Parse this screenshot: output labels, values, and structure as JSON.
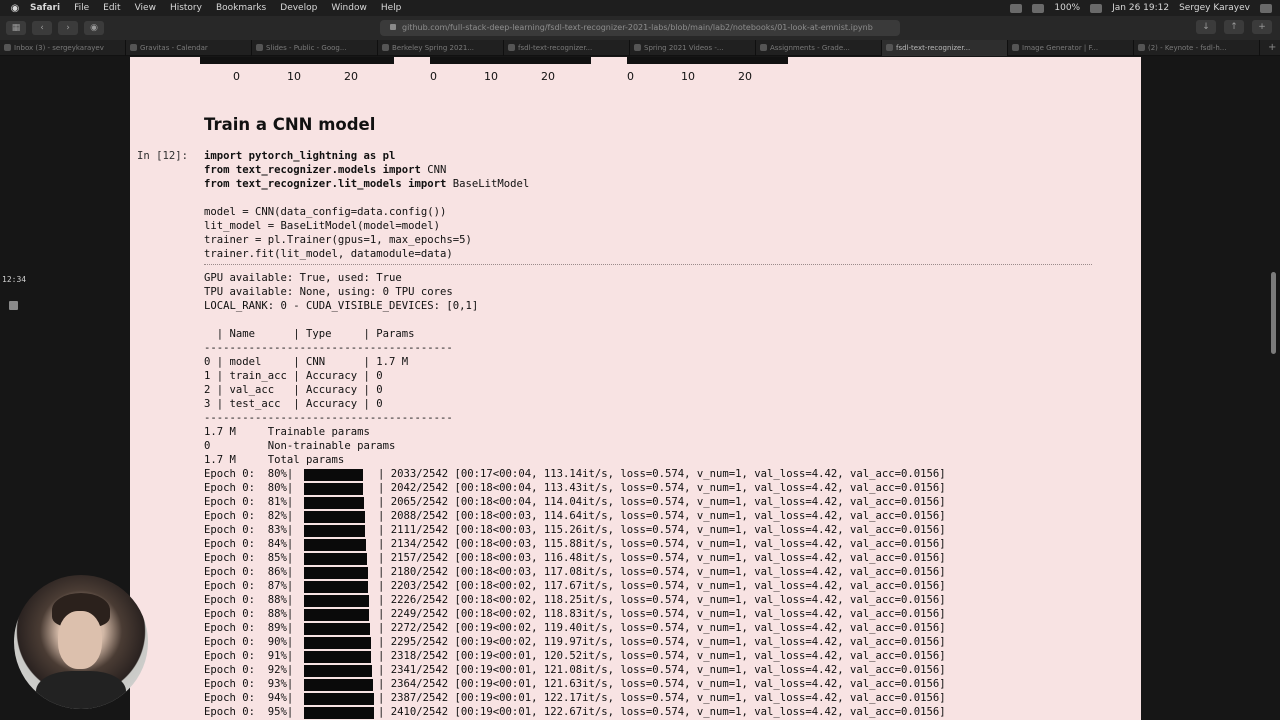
{
  "menubar": {
    "app_name": "Safari",
    "items": [
      "File",
      "Edit",
      "View",
      "History",
      "Bookmarks",
      "Develop",
      "Window",
      "Help"
    ],
    "battery": "100%",
    "datetime": "Jan 26  19:12",
    "user": "Sergey Karayev"
  },
  "toolbar": {
    "url": "github.com/full-stack-deep-learning/fsdl-text-recognizer-2021-labs/blob/main/lab2/notebooks/01-look-at-emnist.ipynb"
  },
  "tabs": [
    {
      "label": "Inbox (3) - sergeykarayev",
      "active": false
    },
    {
      "label": "Gravitas - Calendar",
      "active": false
    },
    {
      "label": "Slides - Public - Goog...",
      "active": false
    },
    {
      "label": "Berkeley Spring 2021...",
      "active": false
    },
    {
      "label": "fsdl-text-recognizer...",
      "active": false
    },
    {
      "label": "Spring 2021 Videos -...",
      "active": false
    },
    {
      "label": "Assignments - Grade...",
      "active": false
    },
    {
      "label": "fsdl-text-recognizer...",
      "active": true
    },
    {
      "label": "Image Generator | F...",
      "active": false
    },
    {
      "label": "(2) - Keynote - fsdl-h...",
      "active": false
    }
  ],
  "side": {
    "timer": "12:34"
  },
  "notebook": {
    "ticks": [
      "0",
      "10",
      "20"
    ],
    "section_title": "Train a CNN model",
    "prompt": "In [12]:",
    "code": [
      {
        "kw1": "import",
        "rest1": " pytorch_lightning ",
        "kw2": "as",
        "rest2": " pl"
      },
      {
        "kw1": "from",
        "rest1": " text_recognizer.models ",
        "kw2": "import",
        "rest2": " CNN"
      },
      {
        "kw1": "from",
        "rest1": " text_recognizer.lit_models ",
        "kw2": "import",
        "rest2": " BaseLitModel"
      }
    ],
    "code2": [
      "model = CNN(data_config=data.config())",
      "lit_model = BaseLitModel(model=model)",
      "trainer = pl.Trainer(gpus=1, max_epochs=5)",
      "trainer.fit(lit_model, datamodule=data)"
    ],
    "output": [
      "GPU available: True, used: True",
      "TPU available: None, using: 0 TPU cores",
      "LOCAL_RANK: 0 - CUDA_VISIBLE_DEVICES: [0,1]",
      "",
      "  | Name      | Type     | Params",
      "---------------------------------------",
      "0 | model     | CNN      | 1.7 M",
      "1 | train_acc | Accuracy | 0",
      "2 | val_acc   | Accuracy | 0",
      "3 | test_acc  | Accuracy | 0",
      "---------------------------------------",
      "1.7 M     Trainable params",
      "0         Non-trainable params",
      "1.7 M     Total params"
    ],
    "epochs": [
      {
        "left": "Epoch 0:  80%|",
        "fill": 0.8,
        "right": "| 2033/2542 [00:17<00:04, 113.14it/s, loss=0.574, v_num=1, val_loss=4.42, val_acc=0.0156]"
      },
      {
        "left": "Epoch 0:  80%|",
        "fill": 0.8,
        "right": "| 2042/2542 [00:18<00:04, 113.43it/s, loss=0.574, v_num=1, val_loss=4.42, val_acc=0.0156]"
      },
      {
        "left": "Epoch 0:  81%|",
        "fill": 0.81,
        "right": "| 2065/2542 [00:18<00:04, 114.04it/s, loss=0.574, v_num=1, val_loss=4.42, val_acc=0.0156]"
      },
      {
        "left": "Epoch 0:  82%|",
        "fill": 0.82,
        "right": "| 2088/2542 [00:18<00:03, 114.64it/s, loss=0.574, v_num=1, val_loss=4.42, val_acc=0.0156]"
      },
      {
        "left": "Epoch 0:  83%|",
        "fill": 0.83,
        "right": "| 2111/2542 [00:18<00:03, 115.26it/s, loss=0.574, v_num=1, val_loss=4.42, val_acc=0.0156]"
      },
      {
        "left": "Epoch 0:  84%|",
        "fill": 0.84,
        "right": "| 2134/2542 [00:18<00:03, 115.88it/s, loss=0.574, v_num=1, val_loss=4.42, val_acc=0.0156]"
      },
      {
        "left": "Epoch 0:  85%|",
        "fill": 0.85,
        "right": "| 2157/2542 [00:18<00:03, 116.48it/s, loss=0.574, v_num=1, val_loss=4.42, val_acc=0.0156]"
      },
      {
        "left": "Epoch 0:  86%|",
        "fill": 0.86,
        "right": "| 2180/2542 [00:18<00:03, 117.08it/s, loss=0.574, v_num=1, val_loss=4.42, val_acc=0.0156]"
      },
      {
        "left": "Epoch 0:  87%|",
        "fill": 0.87,
        "right": "| 2203/2542 [00:18<00:02, 117.67it/s, loss=0.574, v_num=1, val_loss=4.42, val_acc=0.0156]"
      },
      {
        "left": "Epoch 0:  88%|",
        "fill": 0.88,
        "right": "| 2226/2542 [00:18<00:02, 118.25it/s, loss=0.574, v_num=1, val_loss=4.42, val_acc=0.0156]"
      },
      {
        "left": "Epoch 0:  88%|",
        "fill": 0.88,
        "right": "| 2249/2542 [00:18<00:02, 118.83it/s, loss=0.574, v_num=1, val_loss=4.42, val_acc=0.0156]"
      },
      {
        "left": "Epoch 0:  89%|",
        "fill": 0.89,
        "right": "| 2272/2542 [00:19<00:02, 119.40it/s, loss=0.574, v_num=1, val_loss=4.42, val_acc=0.0156]"
      },
      {
        "left": "Epoch 0:  90%|",
        "fill": 0.9,
        "right": "| 2295/2542 [00:19<00:02, 119.97it/s, loss=0.574, v_num=1, val_loss=4.42, val_acc=0.0156]"
      },
      {
        "left": "Epoch 0:  91%|",
        "fill": 0.91,
        "right": "| 2318/2542 [00:19<00:01, 120.52it/s, loss=0.574, v_num=1, val_loss=4.42, val_acc=0.0156]"
      },
      {
        "left": "Epoch 0:  92%|",
        "fill": 0.92,
        "right": "| 2341/2542 [00:19<00:01, 121.08it/s, loss=0.574, v_num=1, val_loss=4.42, val_acc=0.0156]"
      },
      {
        "left": "Epoch 0:  93%|",
        "fill": 0.93,
        "right": "| 2364/2542 [00:19<00:01, 121.63it/s, loss=0.574, v_num=1, val_loss=4.42, val_acc=0.0156]"
      },
      {
        "left": "Epoch 0:  94%|",
        "fill": 0.94,
        "right": "| 2387/2542 [00:19<00:01, 122.17it/s, loss=0.574, v_num=1, val_loss=4.42, val_acc=0.0156]"
      },
      {
        "left": "Epoch 0:  95%|",
        "fill": 0.95,
        "right": "| 2410/2542 [00:19<00:01, 122.67it/s, loss=0.574, v_num=1, val_loss=4.42, val_acc=0.0156]"
      }
    ]
  }
}
